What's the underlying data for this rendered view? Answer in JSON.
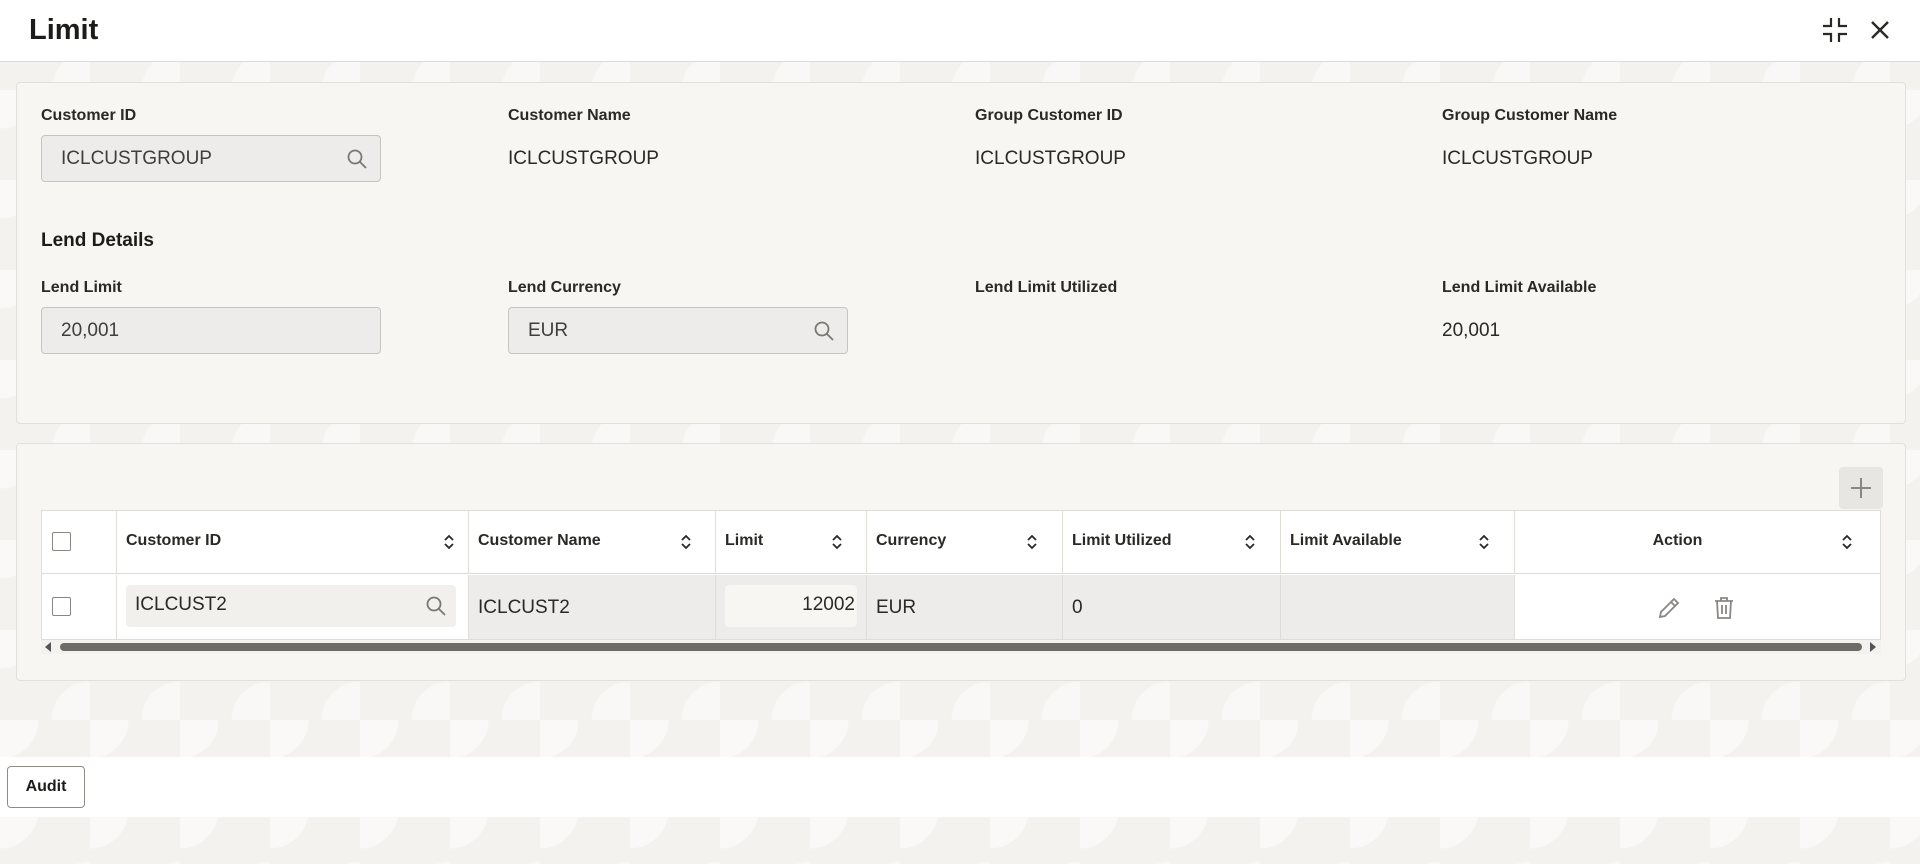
{
  "window": {
    "title": "Limit",
    "minimize_icon": "collapse-icon",
    "close_icon": "close-icon"
  },
  "customer": {
    "customer_id_label": "Customer ID",
    "customer_id_value": "ICLCUSTGROUP",
    "customer_name_label": "Customer Name",
    "customer_name_value": "ICLCUSTGROUP",
    "group_customer_id_label": "Group Customer ID",
    "group_customer_id_value": "ICLCUSTGROUP",
    "group_customer_name_label": "Group Customer Name",
    "group_customer_name_value": "ICLCUSTGROUP"
  },
  "lend_details": {
    "section_title": "Lend Details",
    "lend_limit_label": "Lend Limit",
    "lend_limit_value": "20,001",
    "lend_currency_label": "Lend Currency",
    "lend_currency_value": "EUR",
    "lend_limit_utilized_label": "Lend Limit Utilized",
    "lend_limit_utilized_value": "",
    "lend_limit_available_label": "Lend Limit Available",
    "lend_limit_available_value": "20,001"
  },
  "table": {
    "columns": [
      "Customer ID",
      "Customer Name",
      "Limit",
      "Currency",
      "Limit Utilized",
      "Limit Available",
      "Action"
    ],
    "rows": [
      {
        "customer_id": "ICLCUST2",
        "customer_name": "ICLCUST2",
        "limit": "12002",
        "currency": "EUR",
        "limit_utilized": "0",
        "limit_available": ""
      }
    ]
  },
  "footer": {
    "audit_label": "Audit"
  },
  "colors": {
    "panel_bg": "#f7f6f3",
    "header_bg": "#ffffff",
    "scroll_thumb": "#6e6b67"
  }
}
